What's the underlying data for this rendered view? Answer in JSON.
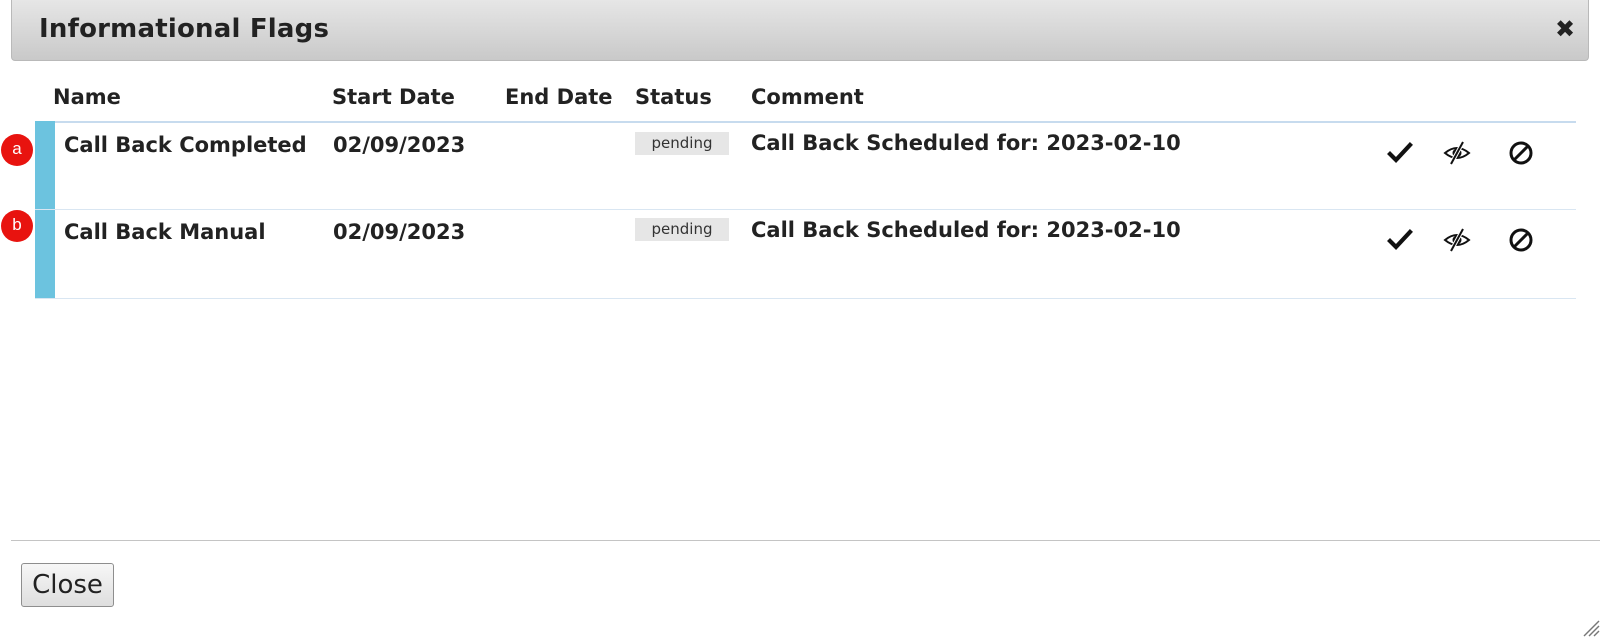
{
  "dialog": {
    "title": "Informational Flags",
    "close_icon": "close-icon",
    "close_glyph": "✖"
  },
  "table": {
    "columns": [
      "Name",
      "Start Date",
      "End Date",
      "Status",
      "Comment"
    ],
    "rows": [
      {
        "marker": "a",
        "name": "Call Back Completed",
        "start_date": "02/09/2023",
        "end_date": "",
        "status": "pending",
        "comment": "Call Back Scheduled for: 2023-02-10",
        "actions": [
          "checkmark-icon",
          "eye-slash-icon",
          "ban-icon"
        ]
      },
      {
        "marker": "b",
        "name": "Call Back Manual",
        "start_date": "02/09/2023",
        "end_date": "",
        "status": "pending",
        "comment": "Call Back Scheduled for: 2023-02-10",
        "actions": [
          "checkmark-icon",
          "eye-slash-icon",
          "ban-icon"
        ]
      }
    ]
  },
  "footer": {
    "close_label": "Close"
  },
  "colors": {
    "row_accent": "#6cc3df",
    "marker": "#e8130f",
    "badge_bg": "#e6e6e6",
    "header_rule": "#c7dbee"
  }
}
